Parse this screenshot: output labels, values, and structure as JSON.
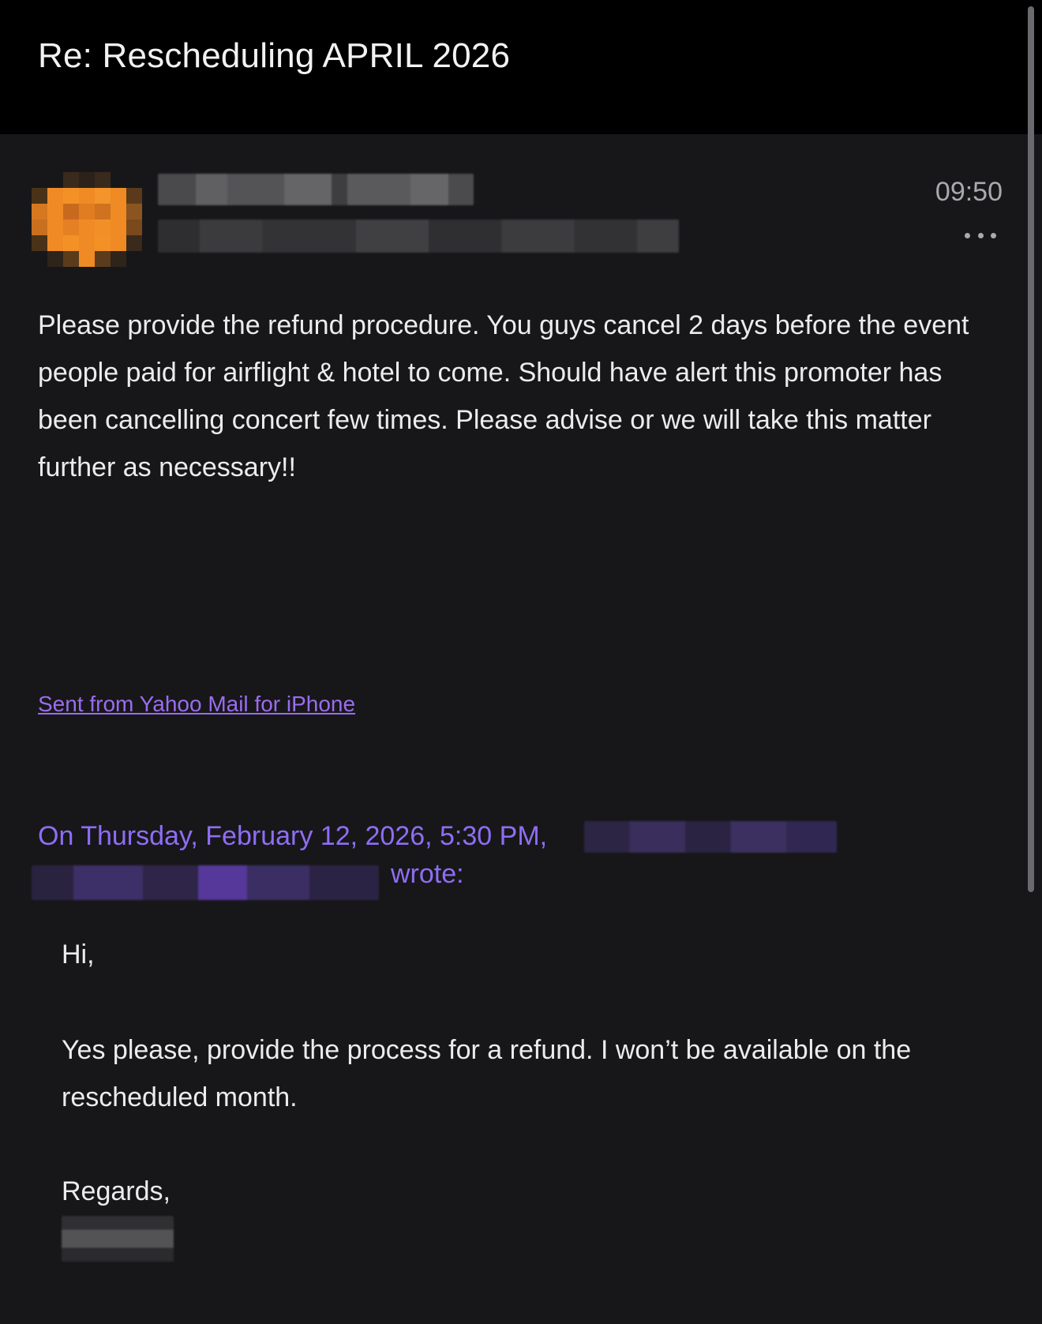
{
  "header": {
    "subject": "Re: Rescheduling APRIL 2026"
  },
  "message": {
    "time": "09:50",
    "more_icon": "more-horizontal-icon",
    "avatar_color": "#f08a24",
    "body": "Please provide the refund procedure. You guys cancel 2 days before the event people paid for airflight & hotel to come. Should have alert this promoter has been cancelling concert few times. Please advise or we will take this matter further as necessary!!",
    "signature_link": "Sent from Yahoo Mail for iPhone"
  },
  "quote": {
    "header": "On Thursday, February 12, 2026, 5:30 PM,",
    "wrote": "wrote:",
    "greeting": "Hi,",
    "body": "Yes please, provide the process for a refund. I won’t be available on the rescheduled month.",
    "closing": "Regards,"
  },
  "colors": {
    "background": "#171719",
    "header_bg": "#000000",
    "link": "#9b6cf0",
    "quote_header": "#8f6df5"
  }
}
